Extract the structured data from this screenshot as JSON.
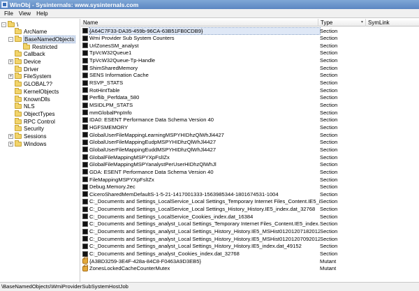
{
  "window": {
    "title": "WinObj - Sysinternals: www.sysinternals.com"
  },
  "menu": [
    "File",
    "View",
    "Help"
  ],
  "tree": [
    {
      "label": "\\",
      "expander": "-",
      "depth": 0
    },
    {
      "label": "ArcName",
      "expander": "",
      "depth": 1
    },
    {
      "label": "BaseNamedObjects",
      "expander": "-",
      "depth": 1,
      "selected": true
    },
    {
      "label": "Restricted",
      "expander": "",
      "depth": 2
    },
    {
      "label": "Callback",
      "expander": "",
      "depth": 1
    },
    {
      "label": "Device",
      "expander": "+",
      "depth": 1
    },
    {
      "label": "Driver",
      "expander": "",
      "depth": 1
    },
    {
      "label": "FileSystem",
      "expander": "+",
      "depth": 1
    },
    {
      "label": "GLOBAL??",
      "expander": "",
      "depth": 1
    },
    {
      "label": "KernelObjects",
      "expander": "",
      "depth": 1
    },
    {
      "label": "KnownDlls",
      "expander": "",
      "depth": 1
    },
    {
      "label": "NLS",
      "expander": "",
      "depth": 1
    },
    {
      "label": "ObjectTypes",
      "expander": "",
      "depth": 1
    },
    {
      "label": "RPC Control",
      "expander": "",
      "depth": 1
    },
    {
      "label": "Security",
      "expander": "",
      "depth": 1
    },
    {
      "label": "Sessions",
      "expander": "+",
      "depth": 1
    },
    {
      "label": "Windows",
      "expander": "+",
      "depth": 1
    }
  ],
  "columns": {
    "name": "Name",
    "type": "Type",
    "symlink": "SymLink"
  },
  "objects": [
    {
      "name": "{A64C7F33-DA35-459b-96CA-63B51FB0CDB9}",
      "type": "Section",
      "icon": "section",
      "selected": true
    },
    {
      "name": "Wmi Provider Sub System Counters",
      "type": "Section",
      "icon": "section"
    },
    {
      "name": "UrlZonesSM_analyst",
      "type": "Section",
      "icon": "section"
    },
    {
      "name": "TpVcW32Queue1",
      "type": "Section",
      "icon": "section"
    },
    {
      "name": "TpVcW32Queue-Tp-Handle",
      "type": "Section",
      "icon": "section"
    },
    {
      "name": "ShimSharedMemory",
      "type": "Section",
      "icon": "section"
    },
    {
      "name": "SENS Information Cache",
      "type": "Section",
      "icon": "section"
    },
    {
      "name": "RSVP_STATS",
      "type": "Section",
      "icon": "section"
    },
    {
      "name": "RotHintTable",
      "type": "Section",
      "icon": "section"
    },
    {
      "name": "Perflib_Perfdata_580",
      "type": "Section",
      "icon": "section"
    },
    {
      "name": "MSIDLPM_STATS",
      "type": "Section",
      "icon": "section"
    },
    {
      "name": "mmGlobalPnpInfo",
      "type": "Section",
      "icon": "section"
    },
    {
      "name": "IDA0:  ESENT Performance Data Schema Version 40",
      "type": "Section",
      "icon": "section"
    },
    {
      "name": "HGFSMEMORY",
      "type": "Section",
      "icon": "section"
    },
    {
      "name": "GlobalUserFileMappingLearningMSPYHIDhzQlWhJl4427",
      "type": "Section",
      "icon": "section"
    },
    {
      "name": "GlobalUserFileMappingEudpMSPYHIDhzQlWhJl4427",
      "type": "Section",
      "icon": "section"
    },
    {
      "name": "GlobalUserFileMappingEuddMSPYHIDhzQlWhJl4427",
      "type": "Section",
      "icon": "section"
    },
    {
      "name": "GlobalFileMappingMSPYXpFslIZx",
      "type": "Section",
      "icon": "section"
    },
    {
      "name": "GlobalFileMappingMSPYanalystPerUserHIDhzQlWhJl",
      "type": "Section",
      "icon": "section"
    },
    {
      "name": "GDA:  ESENT Performance Data Schema Version 40",
      "type": "Section",
      "icon": "section"
    },
    {
      "name": "FileMappingMSPYXpFslIZx",
      "type": "Section",
      "icon": "section"
    },
    {
      "name": "Debug.Memory.2ec",
      "type": "Section",
      "icon": "section"
    },
    {
      "name": "CiceroSharedMemDefaultS-1-5-21-1417001333-1563985344-1801674531-1004",
      "type": "Section",
      "icon": "section"
    },
    {
      "name": "C:_Documents and Settings_LocalService_Local Settings_Temporary Internet Files_Content.IE5_index.dat_32768",
      "type": "Section",
      "icon": "section"
    },
    {
      "name": "C:_Documents and Settings_LocalService_Local Settings_History_History.IE5_index.dat_32768",
      "type": "Section",
      "icon": "section"
    },
    {
      "name": "C:_Documents and Settings_LocalService_Cookies_index.dat_16384",
      "type": "Section",
      "icon": "section"
    },
    {
      "name": "C:_Documents and Settings_analyst_Local Settings_Temporary Internet Files_Content.IE5_index.dat_...",
      "type": "Section",
      "icon": "section"
    },
    {
      "name": "C:_Documents and Settings_analyst_Local Settings_History_History.IE5_MSHist012012071820120719...",
      "type": "Section",
      "icon": "section"
    },
    {
      "name": "C:_Documents and Settings_analyst_Local Settings_History_History.IE5_MSHist012012070920120716...",
      "type": "Section",
      "icon": "section"
    },
    {
      "name": "C:_Documents and Settings_analyst_Local Settings_History_History.IE5_index.dat_49152",
      "type": "Section",
      "icon": "section"
    },
    {
      "name": "C:_Documents and Settings_analyst_Cookies_index.dat_32768",
      "type": "Section",
      "icon": "section"
    },
    {
      "name": "{A3BD3259-3E4F-428a-84C8-F0463A9D3EB5}",
      "type": "Mutant",
      "icon": "mutant"
    },
    {
      "name": "ZonesLockedCacheCounterMutex",
      "type": "Mutant",
      "icon": "mutant"
    }
  ],
  "status": {
    "path": "\\BaseNamedObjects\\WmiProviderSubSystemHostJob"
  }
}
